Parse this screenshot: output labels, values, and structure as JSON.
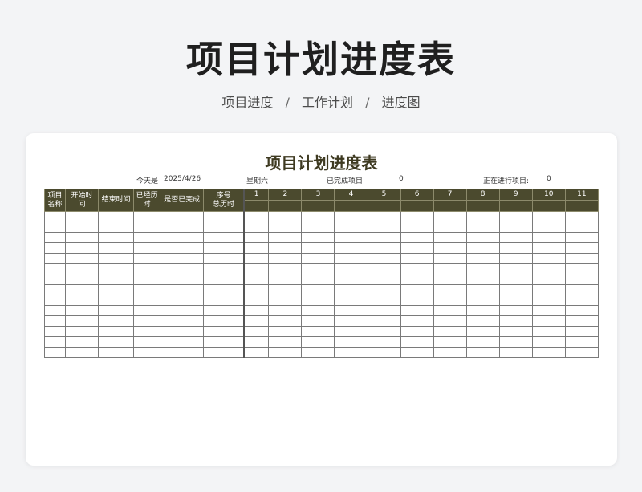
{
  "header": {
    "title": "项目计划进度表",
    "breadcrumb": [
      "项目进度",
      "工作计划",
      "进度图"
    ]
  },
  "sheet": {
    "title": "项目计划进度表",
    "today_label": "今天是",
    "today_value": "2025/4/26",
    "weekday": "星期六",
    "completed_label": "已完成项目:",
    "completed_value": "0",
    "in_progress_label": "正在进行项目:",
    "in_progress_value": "0",
    "columns": {
      "project_name": [
        "项目",
        "名称"
      ],
      "start_time": [
        "开始时",
        "间"
      ],
      "end_time": "结束时间",
      "elapsed": [
        "已经历",
        "时"
      ],
      "is_done": "是否已完成",
      "seq": [
        "序号",
        "总历时"
      ],
      "days": [
        "1",
        "2",
        "3",
        "4",
        "5",
        "6",
        "7",
        "8",
        "9",
        "10",
        "11"
      ]
    }
  }
}
